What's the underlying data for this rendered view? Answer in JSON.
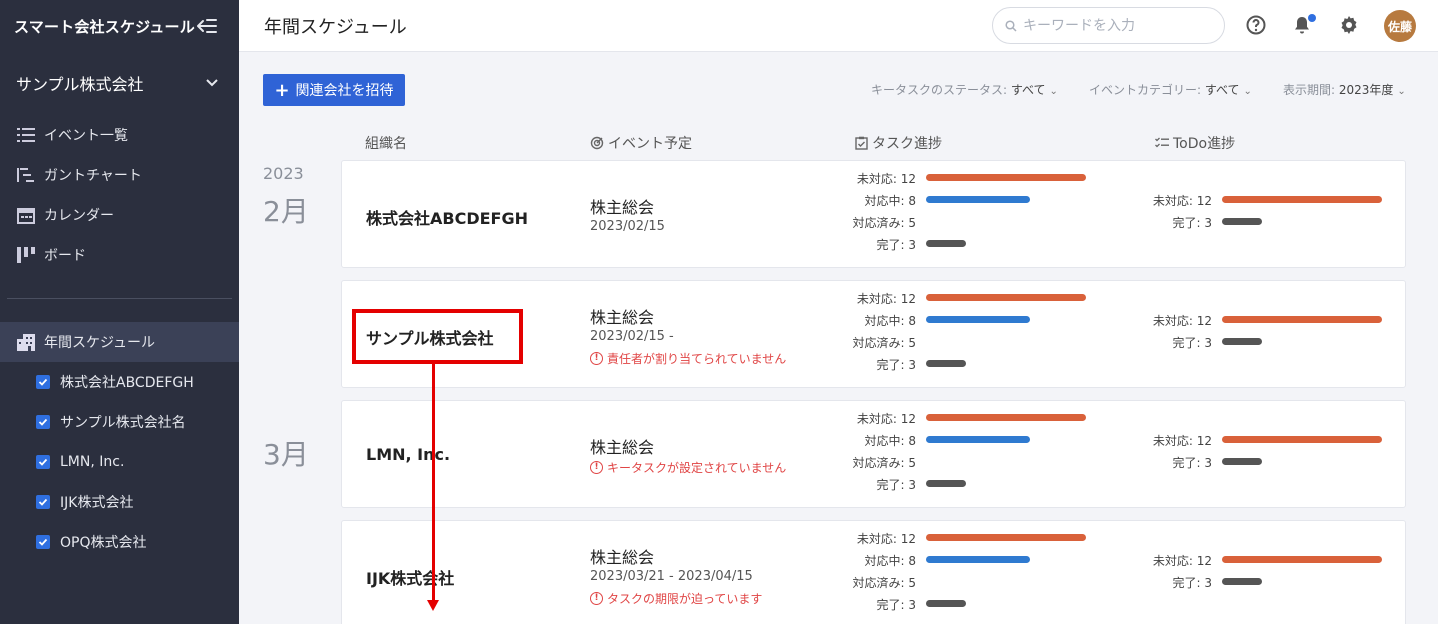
{
  "sidebar": {
    "app_title": "スマート会社スケジュール",
    "company": "サンプル株式会社",
    "nav": [
      {
        "label": "イベント一覧",
        "icon": "list-icon"
      },
      {
        "label": "ガントチャート",
        "icon": "gantt-icon"
      },
      {
        "label": "カレンダー",
        "icon": "calendar-icon"
      },
      {
        "label": "ボード",
        "icon": "board-icon"
      }
    ],
    "active_item": {
      "label": "年間スケジュール",
      "icon": "building-icon"
    },
    "orgs": [
      {
        "label": "株式会社ABCDEFGH",
        "checked": true
      },
      {
        "label": "サンプル株式会社名",
        "checked": true
      },
      {
        "label": "LMN, Inc.",
        "checked": true
      },
      {
        "label": "IJK株式会社",
        "checked": true
      },
      {
        "label": "OPQ株式会社",
        "checked": true
      }
    ]
  },
  "header": {
    "title": "年間スケジュール",
    "search_placeholder": "キーワードを入力",
    "avatar_text": "佐藤",
    "icons": [
      "help-icon",
      "bell-icon",
      "gear-icon"
    ]
  },
  "toolbar": {
    "invite_label": "関連会社を招待",
    "filters": [
      {
        "label": "キータスクのステータス: ",
        "value": "すべて"
      },
      {
        "label": "イベントカテゴリー: ",
        "value": "すべて"
      },
      {
        "label": "表示期間: ",
        "value": "2023年度"
      }
    ]
  },
  "columns": {
    "org": "組織名",
    "event": "イベント予定",
    "task": "タスク進捗",
    "todo": "ToDo進捗"
  },
  "timeline": {
    "year": "2023",
    "months": [
      "2月",
      "3月"
    ]
  },
  "progress_labels": {
    "open": "未対応: ",
    "in_progress": "対応中: ",
    "resolved": "対応済み: ",
    "done": "完了: "
  },
  "rows": [
    {
      "org": "株式会社ABCDEFGH",
      "event_title": "株主総会",
      "event_date": "2023/02/15",
      "warning": "",
      "task": {
        "open": 12,
        "in_progress": 8,
        "resolved": 5,
        "done": 3
      },
      "todo": {
        "open": 12,
        "done": 3
      }
    },
    {
      "org": "サンプル株式会社",
      "event_title": "株主総会",
      "event_date": "2023/02/15 -",
      "warning": "責任者が割り当てられていません",
      "task": {
        "open": 12,
        "in_progress": 8,
        "resolved": 5,
        "done": 3
      },
      "todo": {
        "open": 12,
        "done": 3
      }
    },
    {
      "org": "LMN, Inc.",
      "event_title": "株主総会",
      "event_date": "",
      "warning": "キータスクが設定されていません",
      "task": {
        "open": 12,
        "in_progress": 8,
        "resolved": 5,
        "done": 3
      },
      "todo": {
        "open": 12,
        "done": 3
      }
    },
    {
      "org": "IJK株式会社",
      "event_title": "株主総会",
      "event_date": "2023/03/21 - 2023/04/15",
      "warning": "タスクの期限が迫っています",
      "task": {
        "open": 12,
        "in_progress": 8,
        "resolved": 5,
        "done": 3
      },
      "todo": {
        "open": 12,
        "done": 3
      }
    }
  ],
  "colors": {
    "sidebar_bg": "#2b2f3e",
    "accent": "#2f63d6",
    "open_bar": "#d9613a",
    "in_progress_bar": "#2f7ad0",
    "done_bar": "#555555",
    "warning": "#e04545",
    "annotation": "#e40000"
  }
}
